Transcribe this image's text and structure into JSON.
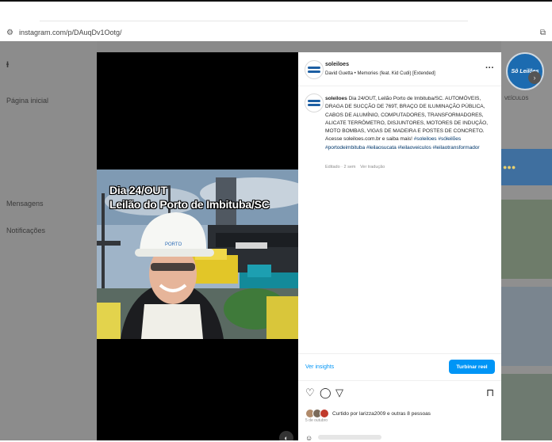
{
  "browser": {
    "url": "instagram.com/p/DAuqDv1Ootg/"
  },
  "background": {
    "sidebar_items": [
      "Página inicial",
      "Mensagens",
      "Notificações"
    ],
    "channel_label": "VEÍCULOS",
    "brand_logo": "Sô Leilões"
  },
  "post": {
    "username": "soleiloes",
    "music": "David Guetta • Memories (feat. Kid Cudi) [Extended]",
    "overlay_line1": "Dia 24/OUT",
    "overlay_line2": "Leilão do Porto de Imbituba/SC",
    "caption_user": "soleiloes",
    "caption_text": "Dia 24/OUT, Leilão Porto de Imbituba/SC. AUTOMÓVEIS, DRAGA DE SUCÇÃO DE 769T, BRAÇO DE ILUMINAÇÃO PÚBLICA, CABOS DE ALUMÍNIO, COMPUTADORES, TRANSFORMADORES, ALICATE TERRÔMETRO, DISJUNTORES, MOTORES DE INDUÇÃO, MOTO BOMBAS, VIGAS DE MADEIRA E POSTES DE CONCRETO. Acesse soleiloes.com.br e saiba mais!",
    "hashtags": "#soleiloes #sóleilões #portodeimbituba #leilaosucata #leilaoveiculos #leilaotransformador",
    "edited": "Editado · 2 sem",
    "see_translation": "Ver tradução",
    "insights_label": "Ver insights",
    "boost_label": "Turbinar reel",
    "liked_by": "Curtido por larizza2009 e outras 8 pessoas",
    "date": "5 de outubro"
  },
  "icons": {
    "site_info": "tune-icon",
    "extension": "extension-icon",
    "more": "more-icon",
    "like": "heart-icon",
    "comment": "comment-icon",
    "share": "send-icon",
    "save": "bookmark-icon",
    "mute": "audio-icon"
  },
  "colors": {
    "accent": "#0095f6",
    "hashtag": "#00376b",
    "brand_blue": "#1d5fa3"
  }
}
